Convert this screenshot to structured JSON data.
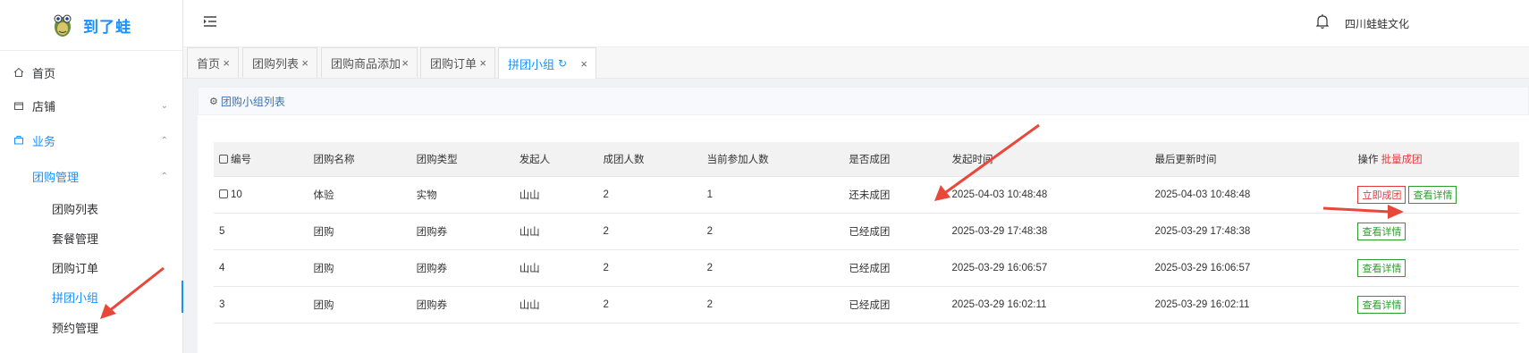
{
  "brand": {
    "name": "到了蛙"
  },
  "header": {
    "company": "四川蛙蛙文化",
    "menu_icon": "menu-fold-icon",
    "bell_icon": "bell-icon"
  },
  "sidebar": {
    "items": [
      {
        "label": "首页",
        "icon": "home-icon"
      },
      {
        "label": "店铺",
        "icon": "shop-icon",
        "arrow": "⌄"
      },
      {
        "label": "业务",
        "icon": "business-icon",
        "arrow": "⌃"
      },
      {
        "label": "团购管理",
        "arrow": "⌃"
      },
      {
        "label": "团购列表"
      },
      {
        "label": "套餐管理"
      },
      {
        "label": "团购订单"
      },
      {
        "label": "拼团小组"
      },
      {
        "label": "预约管理"
      }
    ]
  },
  "tabs": [
    {
      "label": "首页"
    },
    {
      "label": "团购列表"
    },
    {
      "label": "团购商品添加"
    },
    {
      "label": "团购订单"
    },
    {
      "label": "拼团小组"
    }
  ],
  "tab_close": "×",
  "tab_refresh": "↻",
  "panel": {
    "title": "团购小组列表"
  },
  "table": {
    "headers": [
      "编号",
      "团购名称",
      "团购类型",
      "发起人",
      "成团人数",
      "当前参加人数",
      "是否成团",
      "发起时间",
      "最后更新时间",
      "操作"
    ],
    "batch_label": "批量成团",
    "rows": [
      {
        "id": "10",
        "name": "体验",
        "type": "实物",
        "initiator": "山山",
        "required": "2",
        "current": "1",
        "status": "还未成团",
        "start": "2025-04-03 10:48:48",
        "updated": "2025-04-03 10:48:48",
        "actions": [
          "立即成团",
          "查看详情"
        ]
      },
      {
        "id": "5",
        "name": "团购",
        "type": "团购券",
        "initiator": "山山",
        "required": "2",
        "current": "2",
        "status": "已经成团",
        "start": "2025-03-29 17:48:38",
        "updated": "2025-03-29 17:48:38",
        "actions": [
          "查看详情"
        ]
      },
      {
        "id": "4",
        "name": "团购",
        "type": "团购券",
        "initiator": "山山",
        "required": "2",
        "current": "2",
        "status": "已经成团",
        "start": "2025-03-29 16:06:57",
        "updated": "2025-03-29 16:06:57",
        "actions": [
          "查看详情"
        ]
      },
      {
        "id": "3",
        "name": "团购",
        "type": "团购券",
        "initiator": "山山",
        "required": "2",
        "current": "2",
        "status": "已经成团",
        "start": "2025-03-29 16:02:11",
        "updated": "2025-03-29 16:02:11",
        "actions": [
          "查看详情"
        ]
      }
    ]
  },
  "colors": {
    "accent": "#1890ff",
    "danger": "#e4393c",
    "success": "#2c9e2c",
    "annotation": "#e8473a"
  }
}
